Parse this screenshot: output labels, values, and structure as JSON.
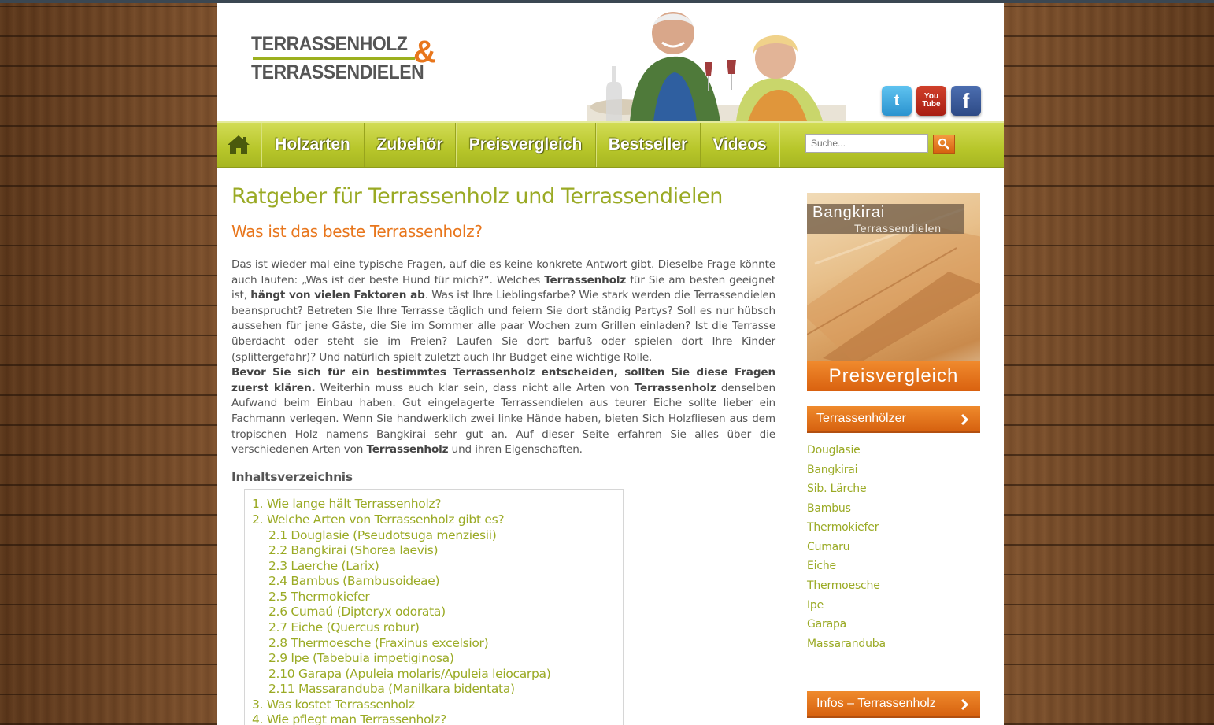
{
  "logo": {
    "line1": "TERRASSENHOLZ",
    "ampersand": "&",
    "line2": "TERRASSENDIELEN"
  },
  "social": [
    {
      "name": "twitter",
      "icon": "twitter-bird-icon",
      "glyph": "t"
    },
    {
      "name": "youtube",
      "icon": "youtube-icon",
      "glyph": "You Tube"
    },
    {
      "name": "facebook",
      "icon": "facebook-icon",
      "glyph": "f"
    }
  ],
  "nav": {
    "home_icon": "house-icon",
    "items": [
      "Holzarten",
      "Zubehör",
      "Preisvergleich",
      "Bestseller",
      "Videos"
    ],
    "search_placeholder": "Suche..."
  },
  "main": {
    "title": "Ratgeber für Terrassenholz und Terrassendielen",
    "subtitle": "Was ist das beste Terrassenholz?",
    "p1_a": "Das ist wieder mal eine typische Fragen, auf die es keine konkrete Antwort gibt. Dieselbe Frage könnte auch lauten: „Was ist der beste Hund für mich?“. Welches ",
    "p1_b": "Terrassenholz",
    "p1_c": " für Sie am besten geeignet ist, ",
    "p1_d": "hängt von vielen Faktoren ab",
    "p1_e": ". Was ist Ihre Lieblingsfarbe? Wie stark werden die Terrassendielen beansprucht? Betreten Sie Ihre Terrasse täglich und feiern Sie dort ständig Partys? Soll es nur hübsch aussehen für jene Gäste, die Sie im Sommer alle paar Wochen zum Grillen einladen? Ist die Terrasse überdacht oder steht sie im Freien? Laufen Sie dort barfuß oder spielen dort Ihre Kinder (splittergefahr)? Und natürlich spielt zuletzt auch Ihr Budget eine wichtige Rolle.",
    "p2_a": "Bevor Sie sich für ein bestimmtes Terrassenholz entscheiden, sollten Sie diese Fragen zuerst klären.",
    "p2_b": " Weiterhin muss auch klar sein, dass nicht alle Arten von ",
    "p2_c": "Terrassenholz",
    "p2_d": " denselben Aufwand beim Einbau haben. Gut eingelagerte Terrassendielen aus teurer Eiche sollte lieber ein Fachmann verlegen. Wenn Sie handwerklich zwei linke Hände haben, bieten Sich Holzfliesen aus dem tropischen Holz namens Bangkirai sehr gut an. Auf dieser Seite erfahren Sie alles über die verschiedenen Arten von ",
    "p2_e": "Terrassenholz",
    "p2_f": " und ihren Eigenschaften.",
    "toc_title": "Inhaltsverzeichnis",
    "toc": [
      "1. Wie lange hält Terrassenholz?",
      "2. Welche Arten von Terrassenholz gibt es?",
      "2.1 Douglasie (Pseudotsuga menziesii)",
      "2.2 Bangkirai (Shorea laevis)",
      "2.3 Laerche (Larix)",
      "2.4 Bambus (Bambusoideae)",
      "2.5 Thermokiefer",
      "2.6 Cumaú (Dipteryx odorata)",
      "2.7 Eiche (Quercus robur)",
      "2.8 Thermoesche (Fraxinus excelsior)",
      "2.9 Ipe (Tabebuia impetiginosa)",
      "2.10 Garapa (Apuleia molaris/Apuleia leiocarpa)",
      "2.11 Massaranduba (Manilkara bidentata)",
      "3. Was kostet Terrassenholz",
      "4. Wie pflegt man Terrassenholz?"
    ]
  },
  "sidebar": {
    "promo": {
      "title": "Bangkirai",
      "subtitle": "Terrassendielen",
      "cta": "Preisvergleich"
    },
    "widget1": "Terrassenhölzer",
    "links": [
      "Douglasie",
      "Bangkirai",
      "Sib. Lärche",
      "Bambus",
      "Thermokiefer",
      "Cumaru",
      "Eiche",
      "Thermoesche",
      "Ipe",
      "Garapa",
      "Massaranduba"
    ],
    "widget2": "Infos – Terrassenholz"
  },
  "colors": {
    "accent_green": "#9aaa24",
    "accent_orange": "#e8761c",
    "nav_green": "#b7c62a"
  }
}
